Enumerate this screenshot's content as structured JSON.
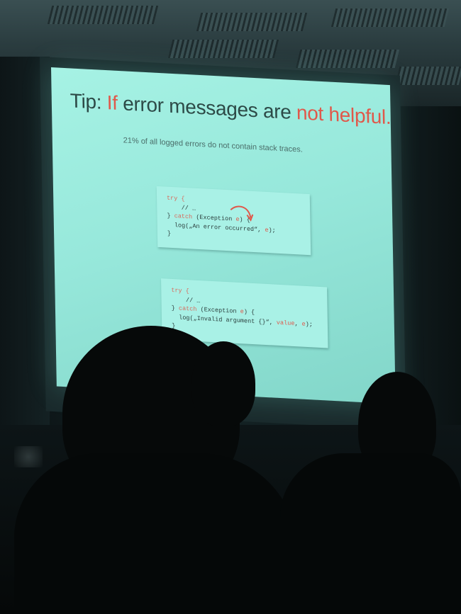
{
  "slide": {
    "title_prefix": "Tip: ",
    "title_if": "If",
    "title_middle": " error messages are ",
    "title_not_helpful": "not helpful...",
    "subtitle": "21% of all logged errors do not contain stack traces.",
    "accent_color": "#e0584a",
    "background_color": "#97e8db"
  },
  "code_block_1": {
    "line1": "try {",
    "line2": "    // …",
    "line3_close": "} ",
    "line3_catch": "catch",
    "line3_rest": " (Exception ",
    "line3_var": "e",
    "line3_end": ") {",
    "line4_start": "  log(„An error occurred“, ",
    "line4_var": "e",
    "line4_end": ");",
    "line5": "}"
  },
  "code_block_2": {
    "line1": "try {",
    "line2": "    // …",
    "line3_close": "} ",
    "line3_catch": "catch",
    "line3_rest": " (Exception ",
    "line3_var": "e",
    "line3_end": ") {",
    "line4_start": "  log(„Invalid argument {}“, ",
    "line4_value": "value",
    "line4_sep": ", ",
    "line4_var": "e",
    "line4_end": ");",
    "line5": "}"
  },
  "icons": {
    "arrow": "curved-arrow-icon"
  }
}
